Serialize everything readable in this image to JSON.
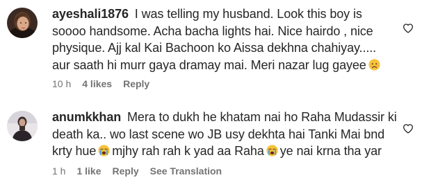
{
  "comments": [
    {
      "username": "ayeshali1876",
      "text_part1": "I was telling my husband. Look this boy is soooo handsome. Acha bacha lights hai. Nice hairdo , nice physique. Ajj kal Kai Bachoon ko Aissa dekhna chahiyay..... aur saath hi murr gaya dramay mai. Meri nazar lug gayee",
      "emoji_end": "sad-face-emoji",
      "time": "10 h",
      "likes": "4 likes",
      "reply": "Reply",
      "like_icon": "heart-outline-icon"
    },
    {
      "username": "anumkkhan",
      "text_part1": "Mera to dukh he khatam nai ho Raha Mudassir ki death ka.. wo last scene wo JB usy dekhta hai Tanki Mai bnd krty hue",
      "text_part2": "mjhy rah rah k yad aa Raha",
      "text_part3": "ye nai krna tha yar",
      "emoji_inline": "crying-face-emoji",
      "time": "1 h",
      "likes": "1 like",
      "reply": "Reply",
      "translation": "See Translation",
      "like_icon": "heart-outline-icon"
    }
  ],
  "colors": {
    "text": "#262626",
    "meta": "#737373",
    "background": "#ffffff"
  }
}
